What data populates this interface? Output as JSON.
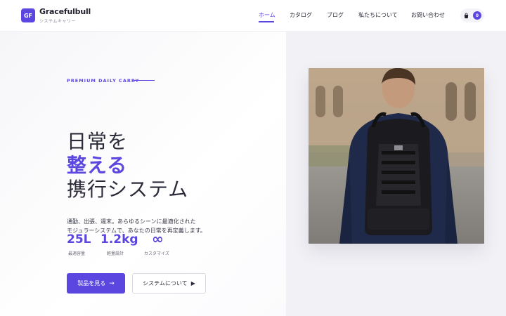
{
  "brand": {
    "logo_text": "GF",
    "name": "Gracefulbull",
    "subtitle": "システムキャリー"
  },
  "nav": {
    "items": [
      {
        "label": "ホーム",
        "active": true
      },
      {
        "label": "カタログ",
        "active": false
      },
      {
        "label": "ブログ",
        "active": false
      },
      {
        "label": "私たちについて",
        "active": false
      },
      {
        "label": "お問い合わせ",
        "active": false
      }
    ],
    "cart_count": "0"
  },
  "hero": {
    "tagline": "PREMIUM DAILY CARRY",
    "headline_line1": "日常を",
    "headline_line2": "整える",
    "headline_line3": "携行システム",
    "description_line1": "通勤、出張、週末。あらゆるシーンに最適化された",
    "description_line2": "モジュラーシステムで、あなたの日常を再定義します。",
    "stats": [
      {
        "value": "25L",
        "label": "最適容量"
      },
      {
        "value": "1.2kg",
        "label": "軽量設計"
      },
      {
        "value": "∞",
        "label": "カスタマイズ"
      }
    ],
    "primary_button": "製品を見る",
    "secondary_button": "システムについて"
  },
  "colors": {
    "accent": "#5b47e0",
    "text": "#2b2b3a",
    "muted": "#6a6a78"
  },
  "icons": {
    "cart": "shopping-bag-icon",
    "arrow": "arrow-right-icon",
    "play": "play-icon"
  }
}
